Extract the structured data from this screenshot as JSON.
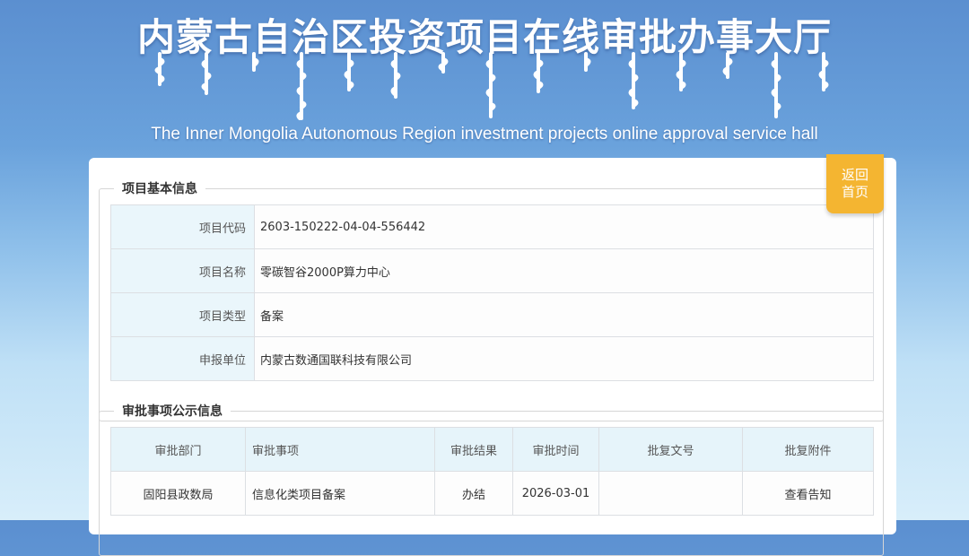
{
  "header": {
    "title_cn": "内蒙古自治区投资项目在线审批办事大厅",
    "title_en": "The Inner Mongolia Autonomous Region investment projects online approval service hall",
    "mongolian_script": "ᠥᠪᠥᠷ ᠮᠣᠩᠭᠣᠯ ᠤᠨ ᠥᠪᠡᠷᠲᠡᠭᠡᠨ ᠵᠠᠰᠠᠬᠤ ᠣᠷᠣᠨ"
  },
  "back_button": {
    "line1": "返回",
    "line2": "首页"
  },
  "basic_info": {
    "legend": "项目基本信息",
    "rows": [
      {
        "label": "项目代码",
        "value": "2603-150222-04-04-556442"
      },
      {
        "label": "项目名称",
        "value": "零碳智谷2000P算力中心"
      },
      {
        "label": "项目类型",
        "value": "备案"
      },
      {
        "label": "申报单位",
        "value": "内蒙古数通国联科技有限公司"
      }
    ]
  },
  "approval_info": {
    "legend": "审批事项公示信息",
    "headers": [
      "审批部门",
      "审批事项",
      "审批结果",
      "审批时间",
      "批复文号",
      "批复附件"
    ],
    "rows": [
      {
        "dept": "固阳县政数局",
        "item": "信息化类项目备案",
        "result": "办结",
        "time": "2026-03-01",
        "doc_no": "",
        "attachment": "查看告知"
      }
    ]
  },
  "colors": {
    "banner_top": "#5b8fd0",
    "banner_bottom": "#d8eefa",
    "back_button": "#f4b531",
    "label_bg": "#eaf6fb"
  }
}
